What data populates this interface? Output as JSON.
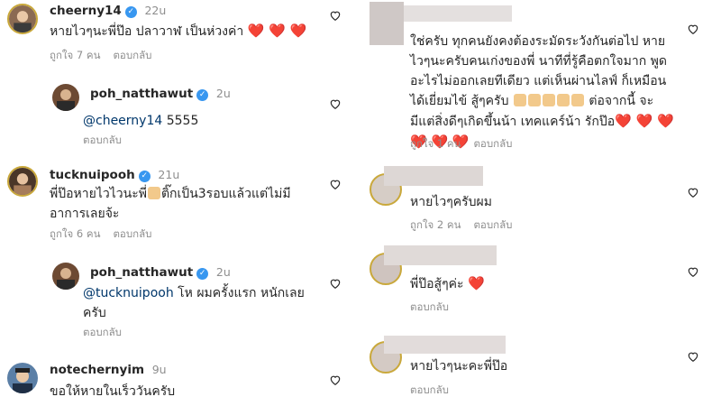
{
  "left": {
    "c1": {
      "username": "cheerny14",
      "time": "22u",
      "text": "หายไวๆนะพี่ป๊อ ปลาวาฬ เป็นห่วงค่า",
      "hearts": "❤️ ❤️ ❤️",
      "likes": "ถูกใจ 7 คน",
      "reply": "ตอบกลับ"
    },
    "c2": {
      "username": "poh_natthawut",
      "time": "2u",
      "mention": "@cheerny14",
      "text": "5555",
      "reply": "ตอบกลับ"
    },
    "c3": {
      "username": "tucknuipooh",
      "time": "21u",
      "text1": "พี่ป๊อหายไวไวนะพี่",
      "text1b": "ติ๊กเป็น3รอบแล้วแต่ไม่มี",
      "text2": "อาการเลยจ้ะ",
      "likes": "ถูกใจ 6 คน",
      "reply": "ตอบกลับ"
    },
    "c4": {
      "username": "poh_natthawut",
      "time": "2u",
      "mention": "@tucknuipooh",
      "text1": "โห ผมครั้งแรก หนักเลย",
      "text2": "ครับ",
      "reply": "ตอบกลับ"
    },
    "c5": {
      "username": "notechernyim",
      "time": "9u",
      "text": "ขอให้หายในเร็ววันครับ"
    }
  },
  "right": {
    "r1": {
      "line1": "ใช่ครับ ทุกคนยังคงต้องระมัดระวังกันต่อไป หาย",
      "line2": "ไวๆนะครับคนเก่งของพี่ นาทีที่รู้คือตกใจมาก พูด",
      "line3": "อะไรไม่ออกเลยทีเดียว แต่เห็นผ่านไลฟ์ ก็เหมือน",
      "line4a": "ได้เยี่ยมไข้ สู้ๆครับ",
      "line4b": "ต่อจากนี้ จะ",
      "line5": "มีแต่สิ่งดีๆเกิดขึ้นน้า เทคแคร์น้า รักป๊อ",
      "hearts5": "❤️ ❤️ ❤️",
      "hearts6": "❤️ ❤️ ❤️",
      "likes": "ถูกใจ 1 คน",
      "reply": "ตอบกลับ"
    },
    "r2": {
      "text": "หายไวๆครับผม",
      "likes": "ถูกใจ 2 คน",
      "reply": "ตอบกลับ"
    },
    "r3": {
      "text": "พี่ป๊อสู้ๆค่ะ",
      "heart": "❤️",
      "reply": "ตอบกลับ"
    },
    "r4": {
      "text": "หายไวๆนะคะพี่ป๊อ",
      "reply": "ตอบกลับ"
    }
  },
  "colors": {
    "heart": "#e0314d",
    "mention": "#00376b",
    "verified": "#3897f0",
    "meta": "#8e8e8e"
  }
}
